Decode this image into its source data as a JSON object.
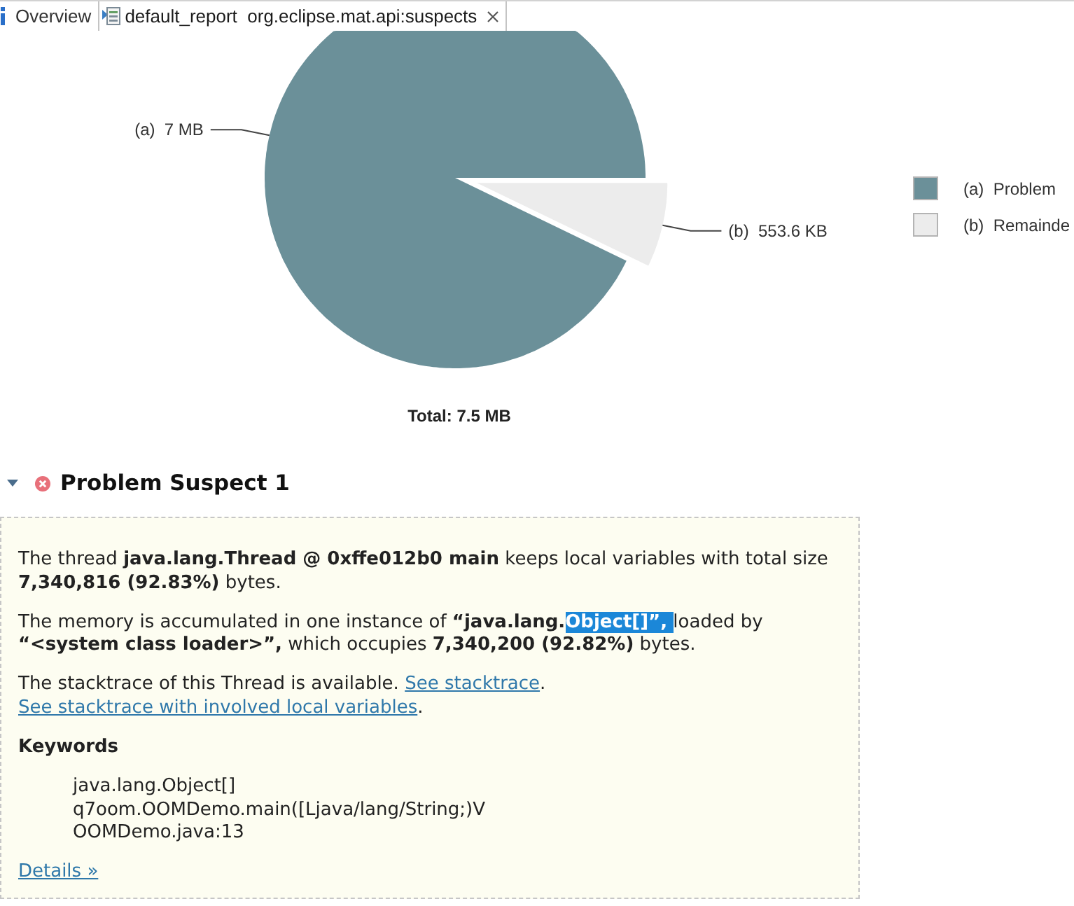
{
  "tabs": [
    {
      "kind": "overview",
      "label": "Overview",
      "selected": false,
      "closable": false
    },
    {
      "kind": "report",
      "label": "default_report  org.eclipse.mat.api:suspects",
      "selected": true,
      "closable": true
    }
  ],
  "chart": {
    "slice_labels": [
      "(a)  7 MB",
      "(b)  553.6 KB"
    ],
    "chart_data": {
      "type": "pie",
      "title": "Total: 7.5 MB",
      "categories": [
        "(a)  Problem",
        "(b)  Remainde"
      ],
      "values": [
        92.83,
        7.17
      ],
      "colors": [
        "#6b9099",
        "#ececec"
      ],
      "legend": true
    }
  },
  "suspect": {
    "title": "Problem Suspect 1",
    "expanded": true,
    "paragraphs": [
      {
        "runs": [
          {
            "kind": "text",
            "text": "The thread **java.lang.Thread @ 0xffe012b0 main** keeps local variables with total size **7,340,816 (92.83%)** bytes.",
            "highlighted": false
          }
        ]
      },
      {
        "runs": [
          {
            "kind": "text",
            "text": "The memory is accumulated in one instance of **“java.lang.**",
            "highlighted": false
          },
          {
            "kind": "text",
            "text": "**Object[]”,** ",
            "highlighted": true
          },
          {
            "kind": "text",
            "text": "loaded by **“<system class loader>”,** which occupies **7,340,200 (92.82%)** bytes.",
            "highlighted": false
          }
        ]
      },
      {
        "runs": [
          {
            "kind": "text",
            "text": "The stacktrace of this Thread is available. ",
            "highlighted": false
          },
          {
            "kind": "link",
            "text": "See stacktrace",
            "highlighted": false
          },
          {
            "kind": "text",
            "text": ". ",
            "highlighted": false
          },
          {
            "kind": "link",
            "text": "See stacktrace with involved local variables",
            "highlighted": false
          },
          {
            "kind": "text",
            "text": ".",
            "highlighted": false
          }
        ]
      }
    ],
    "keywords_heading": "Keywords",
    "keywords": [
      "java.lang.Object[]",
      "q7oom.OOMDemo.main([Ljava/lang/String;)V",
      "OOMDemo.java:13"
    ],
    "details_link": "Details »"
  }
}
